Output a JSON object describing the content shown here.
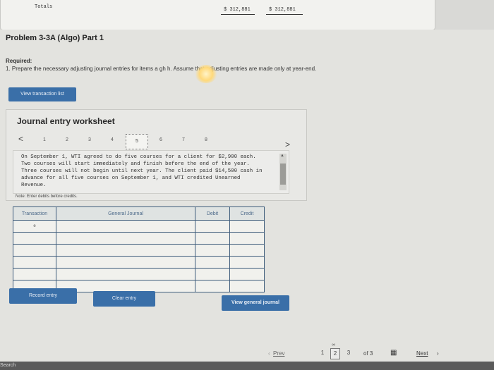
{
  "top_panel": {
    "totals_label": "Totals",
    "amount_debit": "$ 312,881",
    "amount_credit": "$ 312,881"
  },
  "problem_title": "Problem 3-3A (Algo) Part 1",
  "required": {
    "label": "Required:",
    "text": "1. Prepare the necessary adjusting journal entries for items a      gh h. Assume that adjusting entries are made only at year-end."
  },
  "buttons": {
    "view_transaction_list": "View transaction list",
    "record_entry": "Record entry",
    "clear_entry": "Clear entry",
    "view_general_journal": "View general journal"
  },
  "worksheet": {
    "title": "Journal entry worksheet",
    "prev": "<",
    "next": ">",
    "tabs": [
      "1",
      "2",
      "3",
      "4",
      "5",
      "6",
      "7",
      "8"
    ],
    "active_tab": "5",
    "description": "On September 1, WTI agreed to do five courses for a client for $2,900 each. Two courses will start immediately and finish before the end of the year. Three courses will not begin until next year. The client paid $14,500 cash in advance for all five courses on September 1, and WTI credited Unearned Revenue.",
    "note": "Note: Enter debits before credits."
  },
  "journal_table": {
    "headers": [
      "Transaction",
      "General Journal",
      "Debit",
      "Credit"
    ],
    "first_transaction": "e"
  },
  "pager": {
    "prev": "Prev",
    "pages": [
      "1",
      "2",
      "3"
    ],
    "current": "2",
    "of_text": "of 3",
    "next": "Next"
  },
  "taskbar": {
    "search": "Search"
  },
  "colors": {
    "button_blue": "#3a6fa8",
    "table_border": "#3e5c7b",
    "background": "#d9d9d6"
  }
}
